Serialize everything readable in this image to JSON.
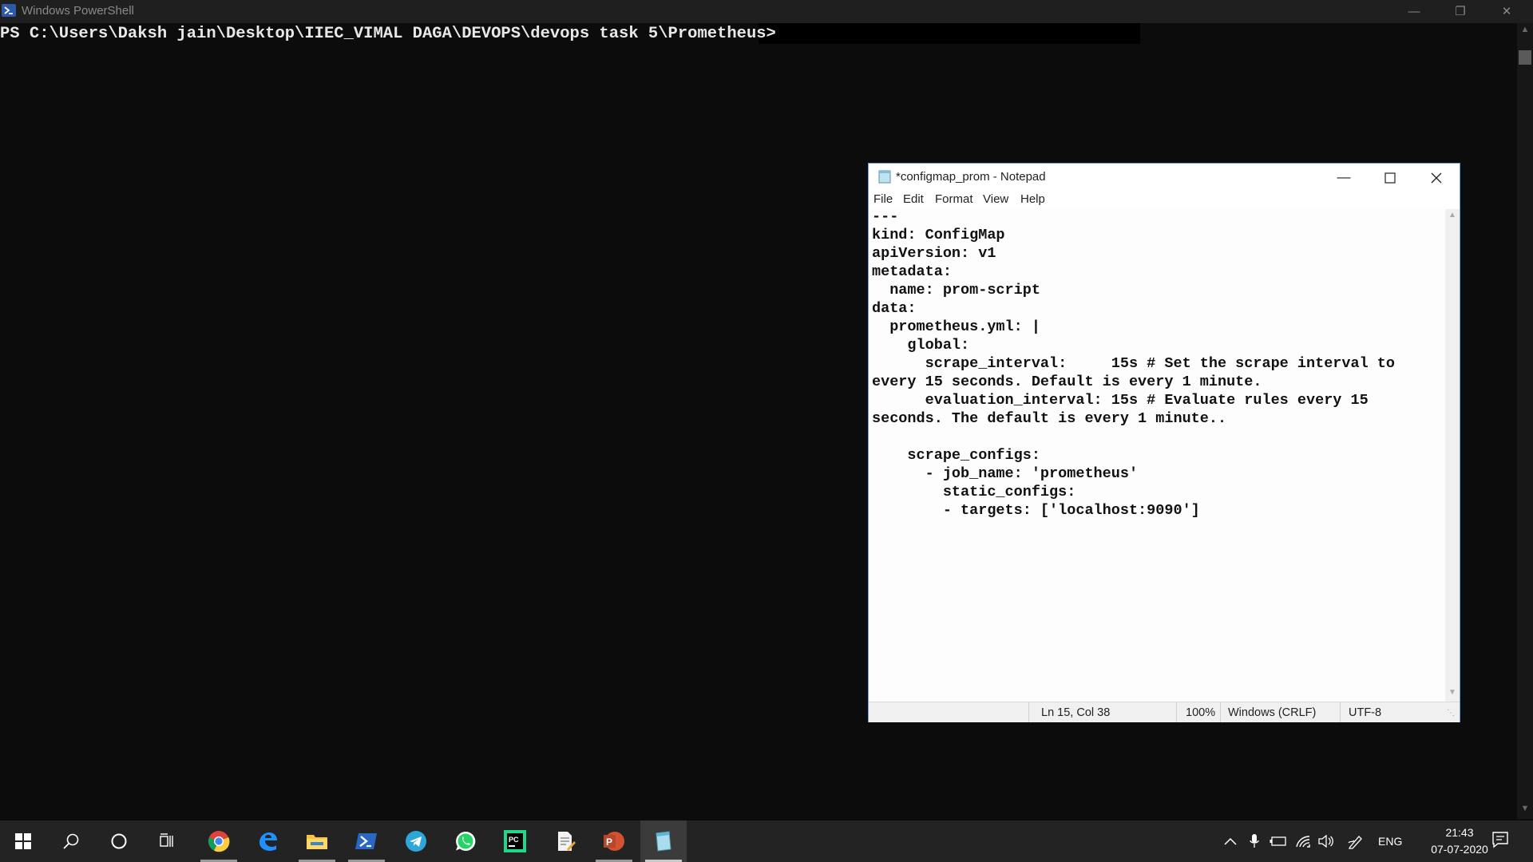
{
  "powershell": {
    "title": "Windows PowerShell",
    "prompt": "PS C:\\Users\\Daksh jain\\Desktop\\IIEC_VIMAL DAGA\\DEVOPS\\devops task 5\\Prometheus>"
  },
  "notepad": {
    "title": "*configmap_prom - Notepad",
    "menu": {
      "file": "File",
      "edit": "Edit",
      "format": "Format",
      "view": "View",
      "help": "Help"
    },
    "content": "---\nkind: ConfigMap\napiVersion: v1\nmetadata:\n  name: prom-script\ndata:\n  prometheus.yml: |\n    global:\n      scrape_interval:     15s # Set the scrape interval to\nevery 15 seconds. Default is every 1 minute.\n      evaluation_interval: 15s # Evaluate rules every 15\nseconds. The default is every 1 minute..\n\n    scrape_configs:\n      - job_name: 'prometheus'\n        static_configs:\n        - targets: ['localhost:9090']",
    "status": {
      "position": "Ln 15, Col 38",
      "zoom": "100%",
      "line_ending": "Windows (CRLF)",
      "encoding": "UTF-8"
    }
  },
  "taskbar": {
    "apps": [
      {
        "name": "start",
        "icon": "windows-start-icon"
      },
      {
        "name": "search",
        "icon": "search-icon"
      },
      {
        "name": "cortana",
        "icon": "cortana-circle-icon"
      },
      {
        "name": "task-view",
        "icon": "task-view-icon"
      },
      {
        "name": "chrome",
        "icon": "chrome-icon"
      },
      {
        "name": "edge",
        "icon": "edge-icon"
      },
      {
        "name": "file-explorer",
        "icon": "folder-icon"
      },
      {
        "name": "powershell",
        "icon": "powershell-icon"
      },
      {
        "name": "telegram",
        "icon": "telegram-icon"
      },
      {
        "name": "whatsapp",
        "icon": "whatsapp-icon"
      },
      {
        "name": "pycharm",
        "icon": "pycharm-icon"
      },
      {
        "name": "file-editor",
        "icon": "document-pen-icon"
      },
      {
        "name": "powerpoint",
        "icon": "powerpoint-icon"
      },
      {
        "name": "notepad",
        "icon": "notepad-icon"
      }
    ],
    "tray": {
      "language": "ENG",
      "time": "21:43",
      "date": "07-07-2020"
    }
  },
  "colors": {
    "console_bg": "#0c0c0c",
    "taskbar_bg": "#232323",
    "notepad_border": "#6b9dd6"
  }
}
